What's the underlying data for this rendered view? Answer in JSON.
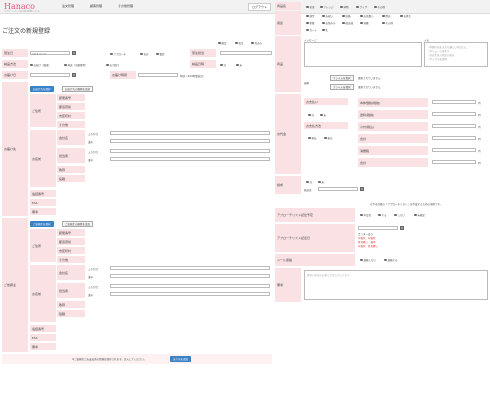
{
  "header": {
    "logo": "Hanaco",
    "logo_sub": "フラワーショップ向け受注管理システム",
    "nav": [
      "注文管理",
      "顧客管理",
      "その他管理"
    ],
    "logout": "ログアウト"
  },
  "page": {
    "title": "ご注文の新規登録"
  },
  "order": {
    "radio_top": [
      "確定",
      "仮注",
      "見込み"
    ],
    "reception_date_label": "受注日",
    "reception_date_value": "2018-07-21",
    "status_options": [
      "アプローチ",
      "来店",
      "電話"
    ],
    "staff_label": "受注担当",
    "method_label": "納品方法",
    "method_options": [
      "お届け（配達）",
      "発送（宅配便等）",
      "お引取り"
    ],
    "inspect_label": "納品日時",
    "inspect_options": [
      "済",
      "未"
    ],
    "delivery_date_label": "お届け日",
    "delivery_time_label": "お届け時間",
    "time_hint": "時頃（※24時間表記）"
  },
  "customer": {
    "section_label": "お届け先",
    "btn_same": "お届け先を選択",
    "btn_history": "お届け先の履歴を追加",
    "fields": [
      "ご住所",
      "お名前",
      "電話番号",
      "FAX",
      "備考"
    ],
    "address_sub": [
      "郵便番号",
      "都道府県",
      "市区町村",
      "その他"
    ],
    "name_sub": [
      "会社名",
      "担当者",
      "敬称",
      "役職"
    ],
    "kana": "ふりがな",
    "kanji": "漢字"
  },
  "orderer": {
    "section_label": "ご依頼主",
    "btn_same": "ご依頼主を選択",
    "btn_history": "ご依頼主の履歴を追加",
    "fields": [
      "ご住所",
      "お名前",
      "電話番号",
      "FAX",
      "備考"
    ]
  },
  "submit": {
    "note": "※ご依頼主とお支払者の情報は保存されます。記入してください。",
    "button": "送り先を追加"
  },
  "right": {
    "type_label": "商品名",
    "type_options": [
      "花束",
      "アレンジ",
      "鉢物",
      "プリザ",
      "その他"
    ],
    "purpose_label": "用途",
    "purpose_options": [
      "誕生",
      "お祝い",
      "結婚",
      "お見舞い",
      "開店",
      "お供え",
      "新築",
      "お悔やみ",
      "歓送迎",
      "退職",
      "その他"
    ],
    "card_options": [
      "カード",
      "札"
    ],
    "message_label": "メッセージ",
    "memo_label": "メモ",
    "memo_hint": [
      "・季節の花を入れた優しい色合いに",
      "・ボリューム多めで",
      "・花は生花で指定の色を",
      "・ボックスを使用"
    ],
    "product_label": "商品",
    "image_label": "画像",
    "file_btn": "ファイルを選択",
    "file_none": "選択されていません",
    "price_label": "お代金",
    "price_fields": [
      "本体価格(税抜)",
      "送料(税抜)",
      "小計(税込)",
      "合計",
      "消費税",
      "合計"
    ],
    "unit": "円",
    "payment_label": "お支払",
    "payment_sub": [
      "お支払い",
      "お支払方法"
    ],
    "paid": [
      "済",
      "未"
    ],
    "pay_method": [
      "後払",
      "振込"
    ],
    "date_label": "請求",
    "date_sub": "発送日",
    "approach_hint": "以下は任意の「アプローチリスト」を作成するための項目です。",
    "approach_label": "アプローチリスト記念予定",
    "approach_opts": [
      "予定日",
      "する",
      "しない",
      "未確定"
    ],
    "approach2_label": "アプローチリスト記念日",
    "approach2_vals": [
      "カンダーあり",
      "年賀状　年賀状",
      "夏見舞い　暑中",
      "年賀状　夏見舞い"
    ],
    "mail_label": "メール連絡",
    "mail_opts": [
      "連絡しない",
      "連絡する"
    ],
    "remark_label": "備考",
    "remark_ph": "請求の予定のお知らせ記入が入ります"
  }
}
